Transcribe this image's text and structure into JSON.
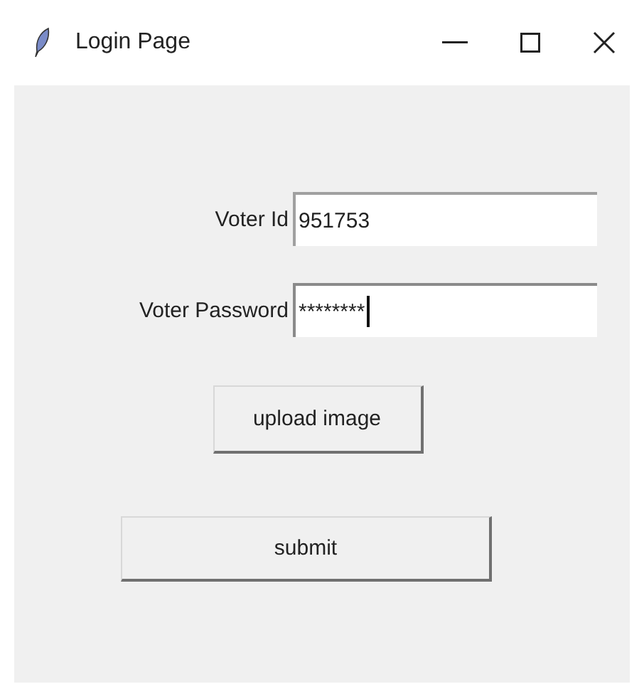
{
  "window": {
    "title": "Login Page"
  },
  "fields": [
    {
      "label": "Voter Id",
      "value": "951753",
      "focused": false
    },
    {
      "label": "Voter Password",
      "value": "********",
      "focused": true
    }
  ],
  "buttons": [
    {
      "label": "upload image",
      "kind": "small"
    },
    {
      "label": "submit",
      "kind": "wide"
    }
  ]
}
